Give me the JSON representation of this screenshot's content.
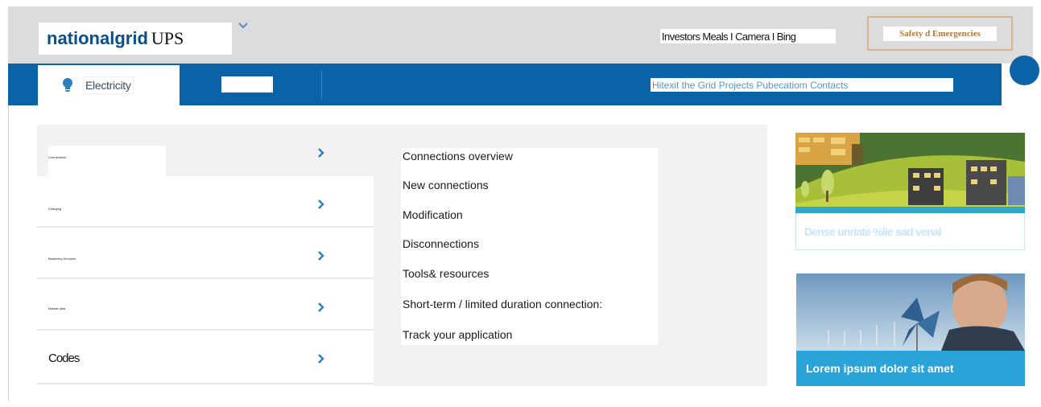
{
  "header": {
    "logo_bold": "nationalgrid",
    "logo_suffix": "UPS",
    "top_links": "Investors Meals I Camera I Bing",
    "safety_label": "Safety d Emergencies"
  },
  "nav": {
    "tabs": [
      {
        "label": "Electricity",
        "icon": "lightbulb-icon"
      },
      {
        "label": ""
      }
    ],
    "links": "Hitexit the Grid Projects Pubecatiom Contacts"
  },
  "menu": {
    "items": [
      {
        "label": "Connections"
      },
      {
        "label": "Charging"
      },
      {
        "label": "Balancing Services"
      },
      {
        "label": "Market data"
      },
      {
        "label": "Codes"
      }
    ]
  },
  "submenu": {
    "items": [
      "Connections overview",
      "New connections",
      "Modification",
      "Disconnections",
      "Tools& resources",
      "Short-term / limited duration connection:",
      "Track your application"
    ]
  },
  "promos": [
    {
      "caption": "Dense unriate %lie sad venal"
    },
    {
      "caption": "Lorem ipsum dolor sit amet"
    }
  ],
  "colors": {
    "brand_blue": "#0a63a6",
    "header_gray": "#dcdcdc",
    "accent_orange": "#d8b48a",
    "chevron_blue": "#2b7fbf",
    "promo_caption_blue": "#2aa3d8"
  }
}
